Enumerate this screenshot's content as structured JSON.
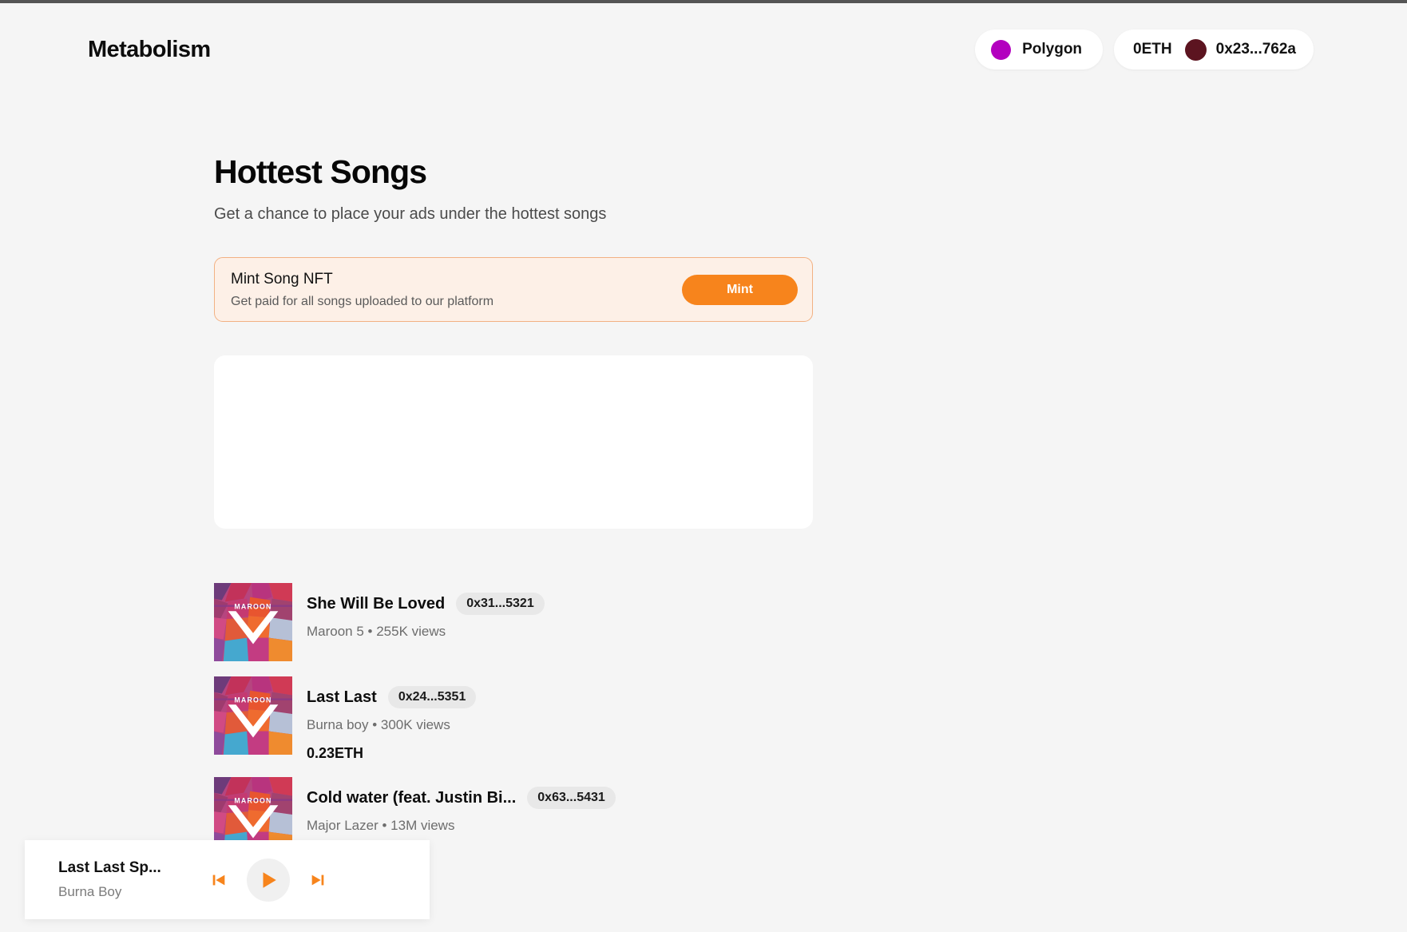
{
  "header": {
    "brand": "Metabolism",
    "network": {
      "label": "Polygon",
      "icon": "polygon-dot-icon",
      "color": "#b300bf"
    },
    "wallet": {
      "balance": "0ETH",
      "address": "0x23...762a",
      "avatar_icon": "wallet-avatar-icon",
      "avatar_color": "#5c1420"
    }
  },
  "main": {
    "title": "Hottest Songs",
    "subtitle": "Get a chance to place your ads under the hottest songs",
    "mint_card": {
      "title": "Mint Song NFT",
      "description": "Get paid for all songs uploaded to our platform",
      "button_label": "Mint",
      "button_color": "#f7841c",
      "background": "#fdf0e7",
      "border_color": "#f2b183"
    },
    "songs": [
      {
        "title": "She Will Be Loved",
        "address": "0x31...5321",
        "artist": "Maroon 5",
        "views": "255K views",
        "meta": "Maroon 5 • 255K views",
        "price": "",
        "cover_label": "MAROON"
      },
      {
        "title": "Last Last",
        "address": "0x24...5351",
        "artist": "Burna boy",
        "views": "300K views",
        "meta": "Burna boy • 300K views",
        "price": "0.23ETH",
        "cover_label": "MAROON"
      },
      {
        "title": "Cold water (feat. Justin Bi...",
        "address": "0x63...5431",
        "artist": "Major Lazer",
        "views": "13M views",
        "meta": "Major Lazer • 13M views",
        "price": "",
        "cover_label": "MAROON"
      }
    ]
  },
  "player": {
    "track": "Last Last Sp...",
    "artist": "Burna Boy",
    "previous_icon": "skip-previous-icon",
    "play_icon": "play-icon",
    "next_icon": "skip-next-icon",
    "accent_color": "#f7841c"
  }
}
